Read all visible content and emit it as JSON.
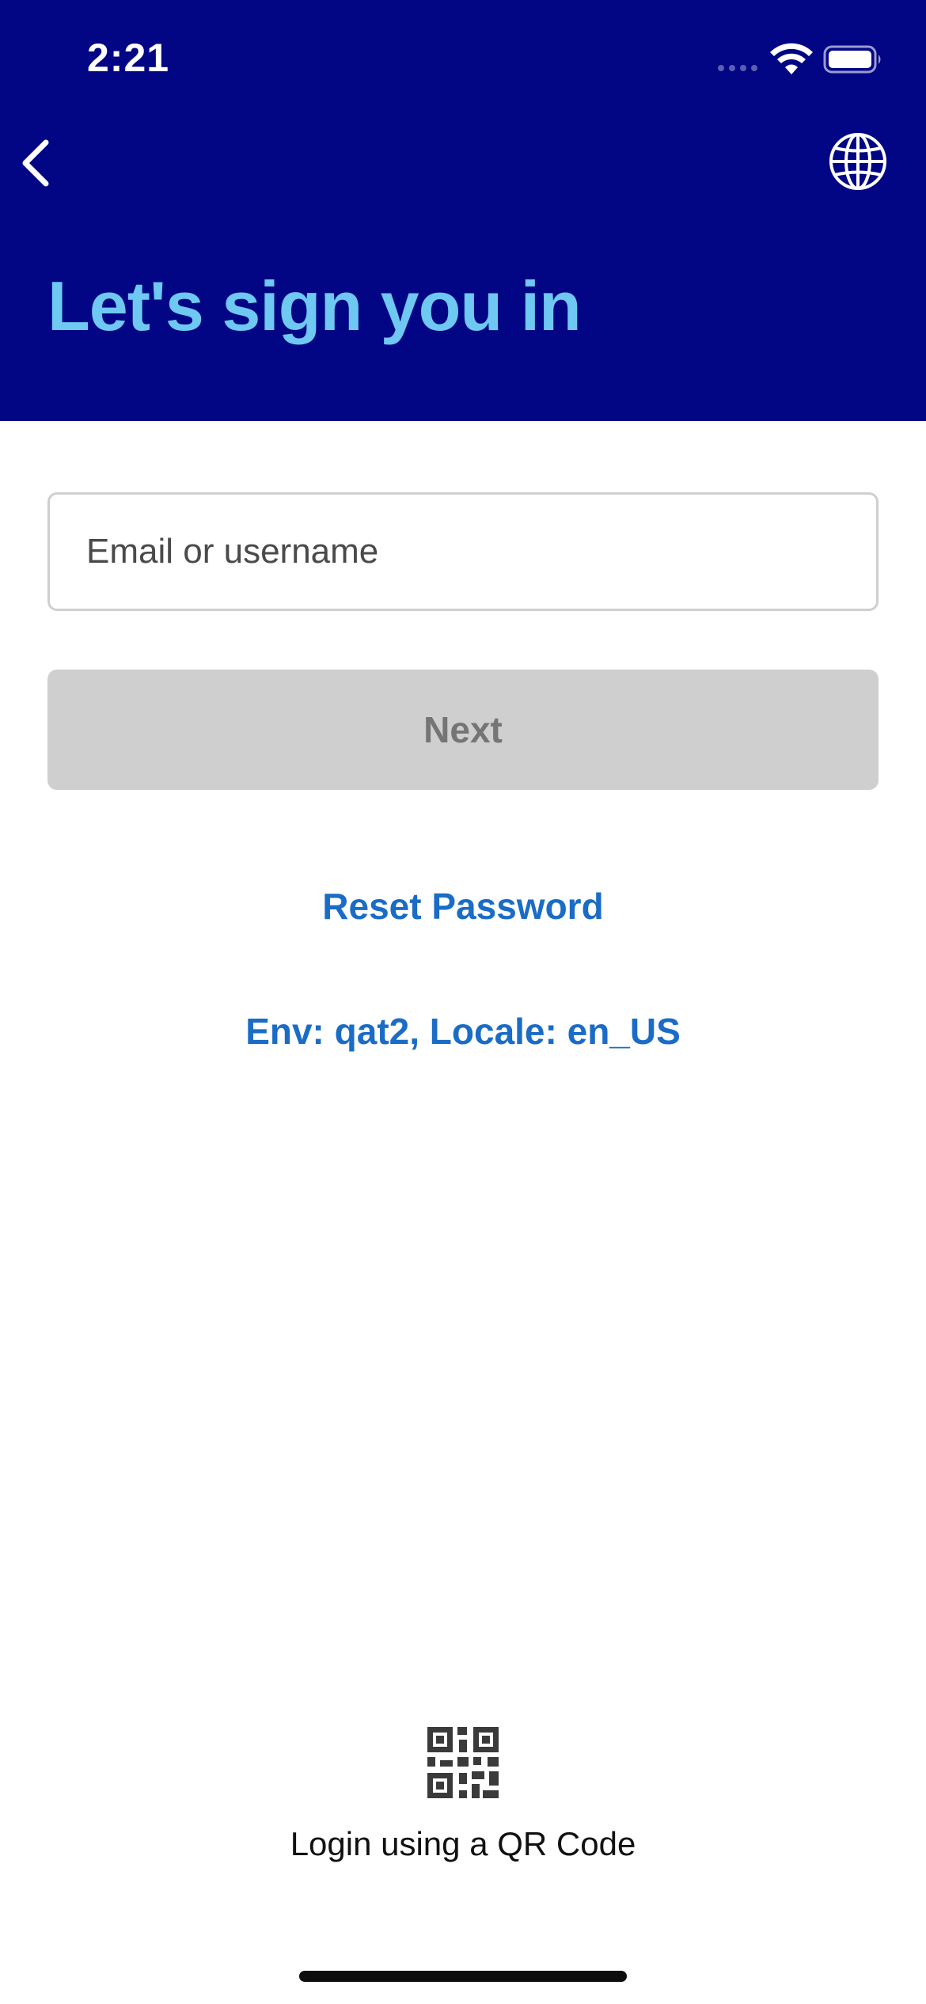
{
  "status_bar": {
    "time": "2:21"
  },
  "header": {
    "title": "Let's sign you in",
    "background_color": "#020684",
    "title_color": "#6ec8f2",
    "back_icon": "chevron-left-icon",
    "language_icon": "globe-icon"
  },
  "form": {
    "email_placeholder": "Email or username",
    "email_value": "",
    "next_label": "Next",
    "next_enabled": false
  },
  "links": {
    "reset_password": "Reset Password",
    "env_info": "Env: qat2, Locale: en_US",
    "link_color": "#1a6cc6"
  },
  "qr_login": {
    "icon": "qr-code-icon",
    "label": "Login using a QR Code"
  }
}
